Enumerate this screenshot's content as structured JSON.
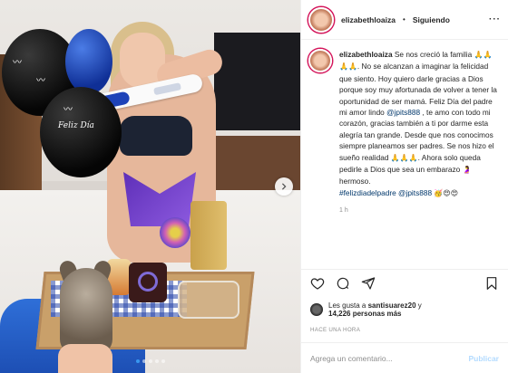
{
  "post": {
    "username": "elizabethloaiza",
    "separator": "•",
    "follow_label": "Siguiendo",
    "more_label": "···"
  },
  "photo": {
    "balloon_text": "Feliz Día",
    "slide_dots": 5,
    "active_dot": 0
  },
  "caption": {
    "username": "elizabethloaiza",
    "part1": " Se nos creció la familia ",
    "emoji1": "🙏🙏🙏🙏",
    "part2": ". No se alcanzan a imaginar la felicidad que siento. Hoy quiero darle gracias a Dios porque soy muy afortunada de volver a tener la oportunidad de ser mamá. Feliz Día del padre mi amor lindo ",
    "mention1": "@jpits888",
    "part3": " , te amo con todo mi corazón, gracias también a ti por darme esta alegría tan grande. Desde que nos conocimos siempre planeamos ser padres. Se nos hizo el sueño realidad ",
    "emoji2": "🙏🙏🙏",
    "part4": ". Ahora solo queda pedirle a Dios que sea un embarazo ",
    "emoji3": "🤰",
    "part5": " hermoso.",
    "hashtag": "#felizdiadelpadre",
    "mention2": "@jpits888",
    "emoji4": "🥳😍😍",
    "time": "1 h"
  },
  "likes": {
    "prefix": "Les gusta a ",
    "user": "santisuarez20",
    "middle": " y",
    "count": "14,226 personas más"
  },
  "timestamp": "HACE UNA HORA",
  "comment": {
    "placeholder": "Agrega un comentario...",
    "publish_label": "Publicar"
  }
}
